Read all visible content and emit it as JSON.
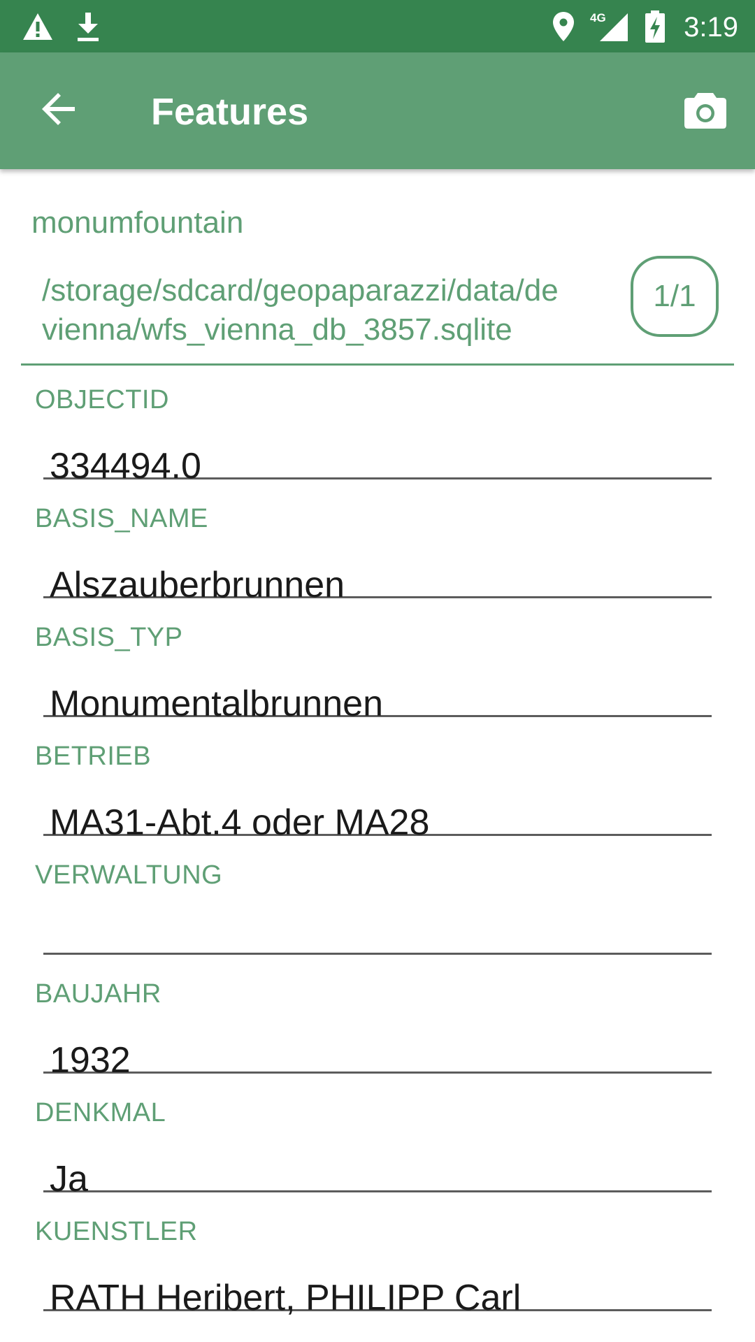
{
  "status_bar": {
    "time": "3:19",
    "network": "4G",
    "icons": [
      "warning-icon",
      "download-icon",
      "location-icon",
      "signal-icon",
      "battery-charging-icon"
    ]
  },
  "app_bar": {
    "title": "Features",
    "back_icon": "arrow-back-icon",
    "camera_icon": "camera-icon"
  },
  "header": {
    "layer_name": "monumfountain",
    "db_path": "/storage/sdcard/geopaparazzi/data/de\nvienna/wfs_vienna_db_3857.sqlite",
    "counter": "1/1"
  },
  "fields": [
    {
      "label": "OBJECTID",
      "value": "334494.0"
    },
    {
      "label": "BASIS_NAME",
      "value": "Alszauberbrunnen"
    },
    {
      "label": "BASIS_TYP",
      "value": "Monumentalbrunnen"
    },
    {
      "label": "BETRIEB",
      "value": "MA31-Abt.4 oder MA28"
    },
    {
      "label": "VERWALTUNG",
      "value": ""
    },
    {
      "label": "BAUJAHR",
      "value": "1932"
    },
    {
      "label": "DENKMAL",
      "value": "Ja"
    },
    {
      "label": "KUENSTLER",
      "value": "RATH Heribert, PHILIPP Carl"
    }
  ],
  "colors": {
    "status_bar": "#36844f",
    "app_bar": "#5f9f75",
    "accent": "#5f9f75",
    "text": "#1a1a1a"
  }
}
